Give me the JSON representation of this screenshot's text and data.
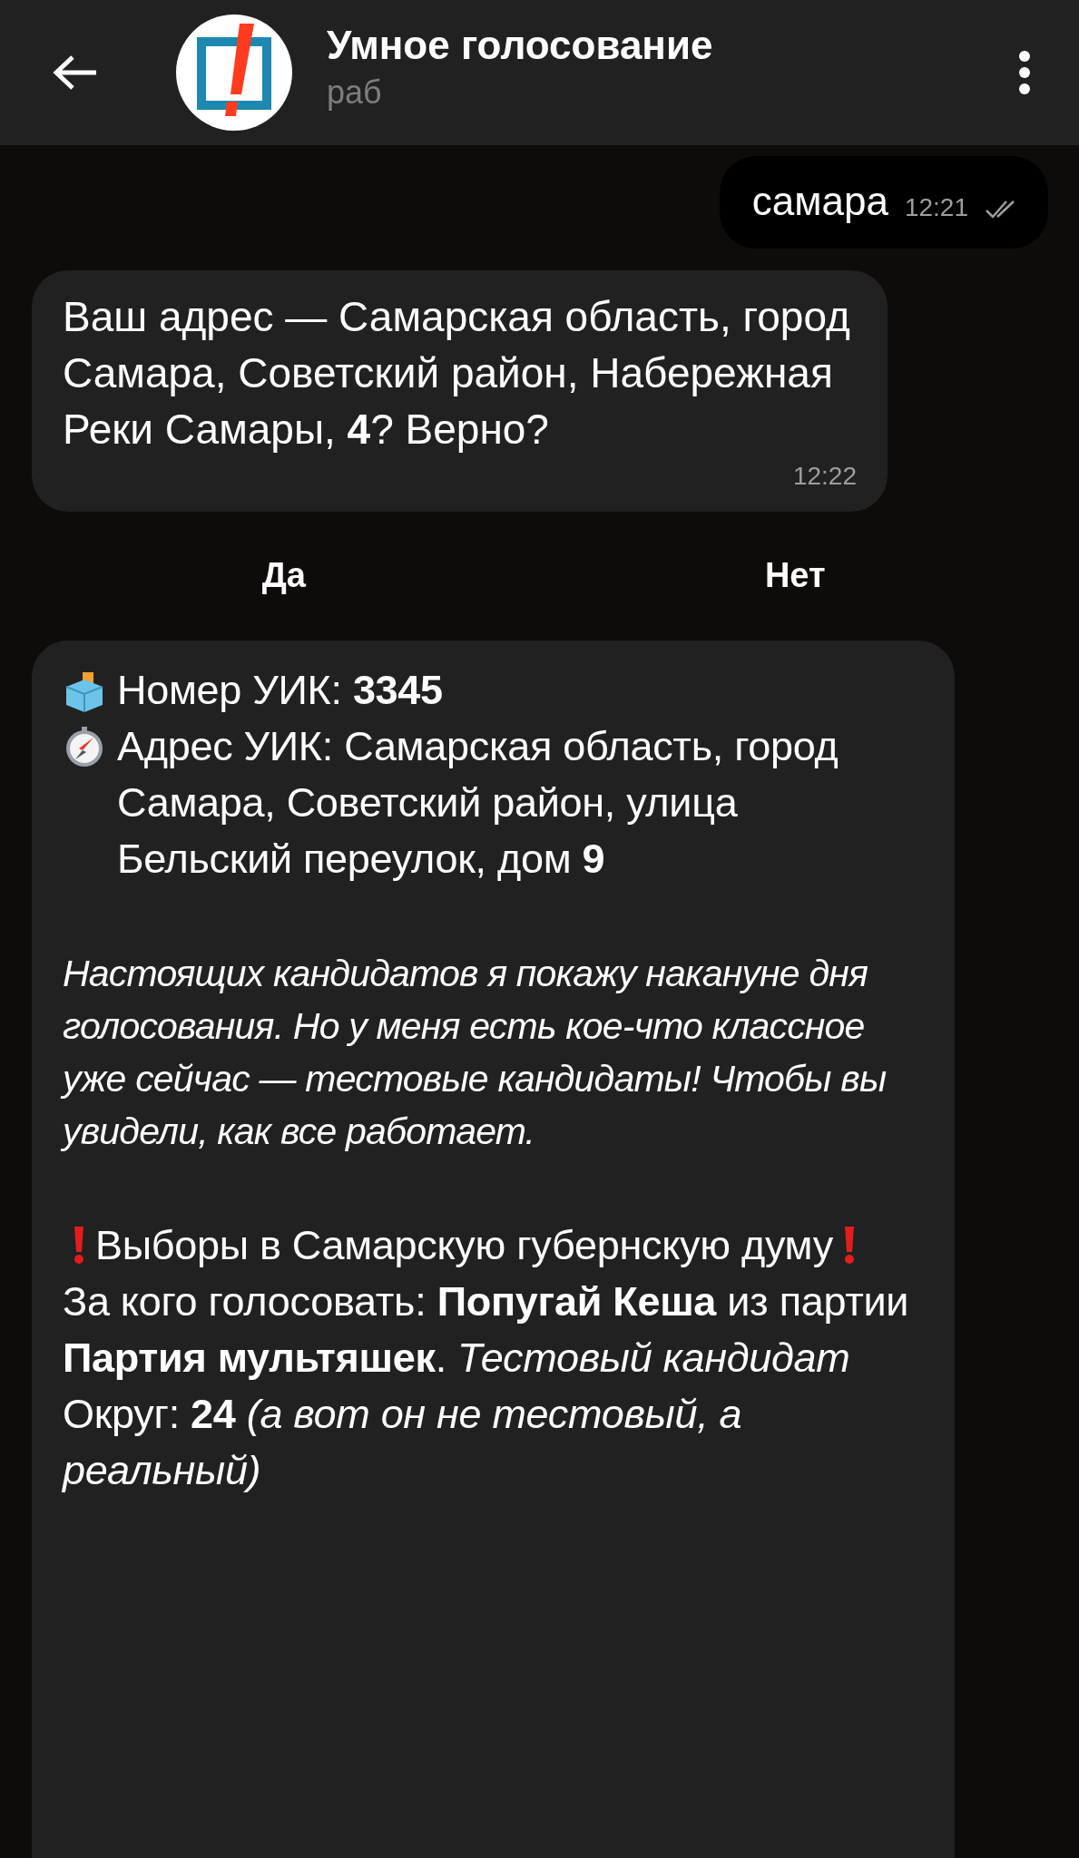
{
  "header": {
    "title": "Умное голосование",
    "subtitle": "раб"
  },
  "messages": [
    {
      "kind": "outgoing",
      "text": "самара",
      "time": "12:21",
      "read": true
    },
    {
      "kind": "incoming",
      "text": "Ваш адрес — Самарская область, город Самара, Советский район, Набережная Реки Самары, **4**? Верно?",
      "time": "12:22"
    }
  ],
  "keyboard": [
    "Да",
    "Нет"
  ],
  "bot_message": {
    "blocks": [
      {
        "kind": "ballot",
        "text": "Номер УИК: **3345**"
      },
      {
        "kind": "stopwatch",
        "text": "Адрес УИК: Самарская область, город Самара, Советский район, улица Бельский переулок, дом **9**"
      },
      {
        "kind": "gap"
      },
      {
        "kind": "italic",
        "text": "Настоящих кандидатов я покажу накануне дня голосования. Но у меня есть кое-что классное уже сейчас — тестовые кандидаты! Чтобы вы увидели, как все работает."
      },
      {
        "kind": "gap"
      },
      {
        "kind": "alert",
        "text": "Выборы в Самарскую губернскую думу"
      },
      {
        "kind": "text",
        "text": "За кого голосовать: **Попугай Кеша** из партии **Партия мультяшек**. *Тестовый кандидат*"
      },
      {
        "kind": "text",
        "text": "Округ: **24** *(а вот он не тестовый, а реальный)*"
      }
    ]
  }
}
